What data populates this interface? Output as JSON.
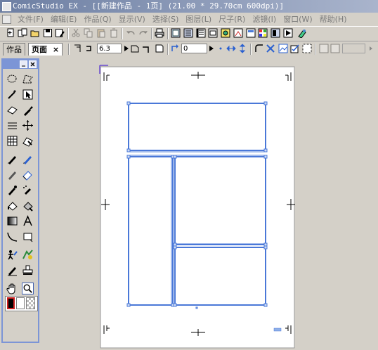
{
  "window": {
    "title": "ComicStudio EX - [[新建作品 - 1页] (21.00 * 29.70cm 600dpi)]"
  },
  "menu": {
    "items": [
      "文件(F)",
      "编辑(E)",
      "作品(Q)",
      "显示(V)",
      "选择(S)",
      "图层(L)",
      "尺子(R)",
      "滤镜(I)",
      "窗口(W)",
      "帮助(H)"
    ]
  },
  "tabs": {
    "work_label": "作品",
    "page_label": "页面",
    "close_glyph": "×"
  },
  "toolbar2": {
    "line_width_value": "6.3",
    "angle_value": "0"
  },
  "colors": {
    "panel_border": "#7c95d6",
    "frame_blue": "#4a78d8",
    "page_fill": "#ffffff",
    "canvas_bg": "#d4d0c8",
    "title_bar_start": "#6d7fa3",
    "title_bar_end": "#a9b4cc"
  },
  "icons": {
    "toolbar1": [
      "new-page-icon",
      "new-story-icon",
      "open-icon",
      "save-icon",
      "save-as-icon",
      "cut-icon",
      "copy-icon",
      "paste-icon",
      "delete-icon",
      "undo-icon",
      "redo-icon",
      "print-icon",
      "page-view-icon",
      "story-view-icon",
      "layer-icon",
      "layer-property-icon",
      "color-icon",
      "navigator-icon",
      "tool-option-icon",
      "grid-icon",
      "material-icon",
      "materials-icon",
      "settings-icon"
    ],
    "tools": [
      "lasso-select-icon",
      "polygon-select-icon",
      "magic-wand-icon",
      "object-select-icon",
      "eraser-select-icon",
      "pick-icon",
      "ruler-icon",
      "move-icon",
      "grid-icon",
      "layer-move-icon",
      "pen-icon",
      "pencil-icon",
      "marker-icon",
      "eraser-icon",
      "brush-icon",
      "airbrush-icon",
      "fill-icon",
      "pattern-fill-icon",
      "gradient-icon",
      "text-icon",
      "curve-icon",
      "rect-shape-icon",
      "person-icon",
      "speed-line-icon",
      "correction-icon",
      "stamp-icon",
      "hand-icon",
      "zoom-icon"
    ]
  }
}
